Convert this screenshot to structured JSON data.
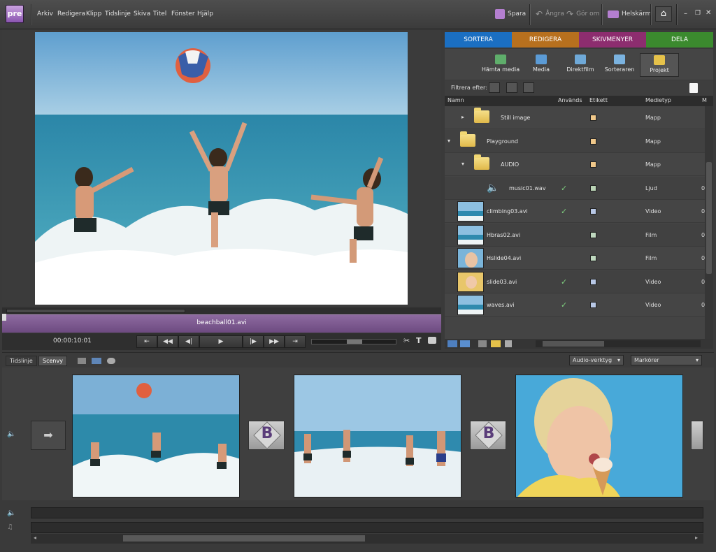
{
  "app": {
    "logo": "pre"
  },
  "menu": [
    "Arkiv",
    "Redigera",
    "Klipp",
    "Tidslinje",
    "Skiva",
    "Titel",
    "Fönster",
    "Hjälp"
  ],
  "toolbar": {
    "save": "Spara",
    "undo": "Ångra",
    "redo": "Gör om",
    "fullscreen": "Helskärm"
  },
  "monitor": {
    "clip_name": "beachball01.avi",
    "timecode": "00:00:10:01"
  },
  "tabs": [
    {
      "label": "SORTERA",
      "color": "#1b6fc2"
    },
    {
      "label": "REDIGERA",
      "color": "#b7701e"
    },
    {
      "label": "SKIVMENYER",
      "color": "#8d2d6f"
    },
    {
      "label": "DELA",
      "color": "#3b8a2e"
    }
  ],
  "tools": [
    "Hämta media",
    "Media",
    "Direktfilm",
    "Sorteraren",
    "Projekt"
  ],
  "filter": {
    "label": "Filtrera efter:"
  },
  "columns": {
    "name": "Namn",
    "used": "Används",
    "label": "Etikett",
    "mediatype": "Medietyp",
    "extra": "M"
  },
  "items": [
    {
      "name": "Still image",
      "type": "folder",
      "indent": 1,
      "expanded": false,
      "used": false,
      "label_color": "#f0c88a",
      "mediatype": "Mapp",
      "extra": ""
    },
    {
      "name": "Playground",
      "type": "folder",
      "indent": 0,
      "expanded": true,
      "used": false,
      "label_color": "#f0c88a",
      "mediatype": "Mapp",
      "extra": ""
    },
    {
      "name": "AUDIO",
      "type": "folder",
      "indent": 1,
      "expanded": true,
      "used": false,
      "label_color": "#f0c88a",
      "mediatype": "Mapp",
      "extra": ""
    },
    {
      "name": "music01.wav",
      "type": "audio",
      "indent": 2,
      "used": true,
      "label_color": "#b9d2b4",
      "mediatype": "Ljud",
      "extra": "0"
    },
    {
      "name": "climbing03.avi",
      "type": "video",
      "thumb": "beach",
      "used": true,
      "label_color": "#b8c8e6",
      "mediatype": "Video",
      "extra": "0"
    },
    {
      "name": "Hbras02.avi",
      "type": "video",
      "thumb": "beach",
      "used": false,
      "label_color": "#bfd8bf",
      "mediatype": "Film",
      "extra": "0"
    },
    {
      "name": "Hslide04.avi",
      "type": "video",
      "thumb": "face",
      "used": false,
      "label_color": "#bfd8bf",
      "mediatype": "Film",
      "extra": "0"
    },
    {
      "name": "slide03.avi",
      "type": "video",
      "thumb": "kid",
      "used": true,
      "label_color": "#b8c8e6",
      "mediatype": "Video",
      "extra": "0"
    },
    {
      "name": "waves.avi",
      "type": "video",
      "thumb": "beach",
      "used": true,
      "label_color": "#b8c8e6",
      "mediatype": "Video",
      "extra": "0"
    }
  ],
  "bottom": {
    "tab_timeline": "Tidslinje",
    "tab_sceneview": "Scenvy",
    "audio_tools": "Audio-verktyg",
    "markers": "Markörer"
  },
  "transitions": [
    "B",
    "B"
  ]
}
